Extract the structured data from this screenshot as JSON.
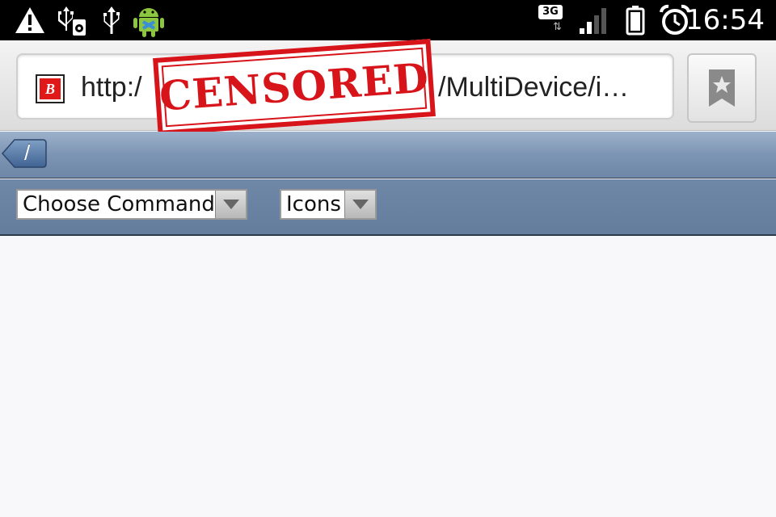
{
  "status_bar": {
    "icons": [
      "warning-icon",
      "usb-debug-icon",
      "usb-icon",
      "android-icon",
      "signal-icon",
      "battery-icon",
      "alarm-icon"
    ],
    "network_type": "3G",
    "time": "16:54"
  },
  "browser": {
    "url_prefix": "http:/",
    "url_suffix": "/MultiDevice/i…",
    "favicon_letter": "B",
    "stamp_text": "CENSORED"
  },
  "app": {
    "back_label": "/",
    "command_select": {
      "selected": "Choose Command"
    },
    "view_select": {
      "selected": "Icons"
    }
  },
  "colors": {
    "stamp_red": "#d7141a",
    "header_blue": "#7d95b4",
    "toolbar_blue": "#6a83a3"
  }
}
